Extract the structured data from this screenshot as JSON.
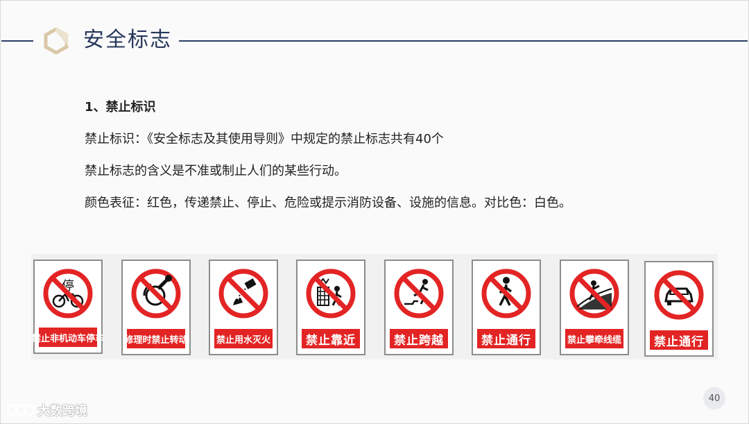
{
  "slide": {
    "title": "安全标志",
    "page_number": "40"
  },
  "content": {
    "heading": "1、禁止标识",
    "paragraphs": [
      "禁止标识：《安全标志及其使用导则》中规定的禁止标志共有40个",
      "禁止标志的含义是不准或制止人们的某些行动。",
      "颜色表征：红色，传递禁止、停止、危险或提示消防设备、设施的信息。对比色：白色。"
    ]
  },
  "signs": [
    {
      "label": "禁止非机动车停车",
      "icon": "no-bicycle-parking-icon"
    },
    {
      "label": "修理时禁止转动",
      "icon": "no-turning-during-repair-icon"
    },
    {
      "label": "禁止用水灭火",
      "icon": "no-water-extinguishing-icon"
    },
    {
      "label": "禁止靠近",
      "icon": "no-approaching-icon"
    },
    {
      "label": "禁止跨越",
      "icon": "no-crossing-icon"
    },
    {
      "label": "禁止通行",
      "icon": "no-passage-icon"
    },
    {
      "label": "禁止攀牵线缆",
      "icon": "no-climbing-cables-icon"
    },
    {
      "label": "禁止通行",
      "icon": "no-vehicle-passage-icon"
    }
  ],
  "watermark": {
    "text": "大数跨境"
  },
  "colors": {
    "title": "#26365a",
    "rule": "#2c3e66",
    "prohibition_red": "#e32424"
  }
}
